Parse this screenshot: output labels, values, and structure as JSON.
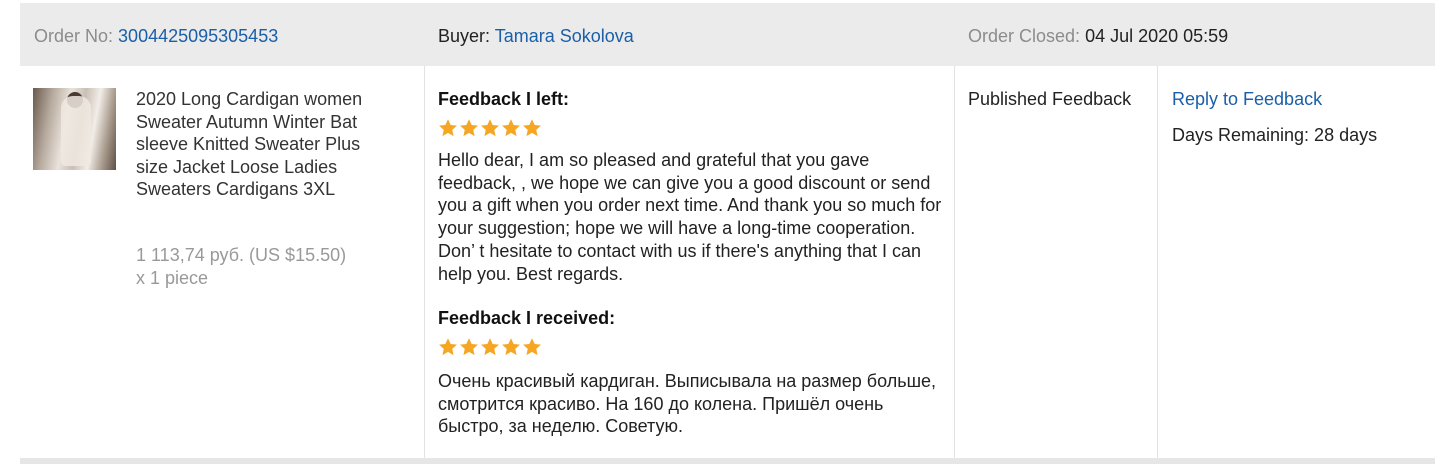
{
  "header": {
    "order_label": "Order No:",
    "order_number": "3004425095305453",
    "buyer_label": "Buyer:",
    "buyer_name": "Tamara Sokolova",
    "closed_label": "Order Closed:",
    "closed_date": "04 Jul 2020 05:59"
  },
  "product": {
    "title": "2020 Long Cardigan women Sweater Autumn Winter Bat sleeve Knitted Sweater Plus size Jacket Loose Ladies Sweaters Cardigans 3XL",
    "price": "1 113,74 руб. (US $15.50)",
    "quantity": "x 1 piece"
  },
  "feedback_left": {
    "heading": "Feedback I left:",
    "stars": 5,
    "text": "Hello dear, I am so pleased and grateful that you gave feedback, , we hope we can give you a good discount or send you a gift when you order next time. And thank you so much for your suggestion; hope we will have a long-time cooperation. Don’ t hesitate to contact with us if there's anything that I can help you. Best regards."
  },
  "feedback_received": {
    "heading": "Feedback I received:",
    "stars": 5,
    "text": "Очень красивый кардиган. Выписывала на размер больше, смотрится красиво. На 160 до колена. Пришёл очень быстро, за неделю. Советую."
  },
  "status": {
    "label": "Published Feedback"
  },
  "actions": {
    "reply_label": "Reply to Feedback",
    "days_remaining": "Days Remaining: 28 days"
  },
  "colors": {
    "star": "#f5a623",
    "link": "#1a5fa8",
    "header_bg": "#ebebeb"
  }
}
